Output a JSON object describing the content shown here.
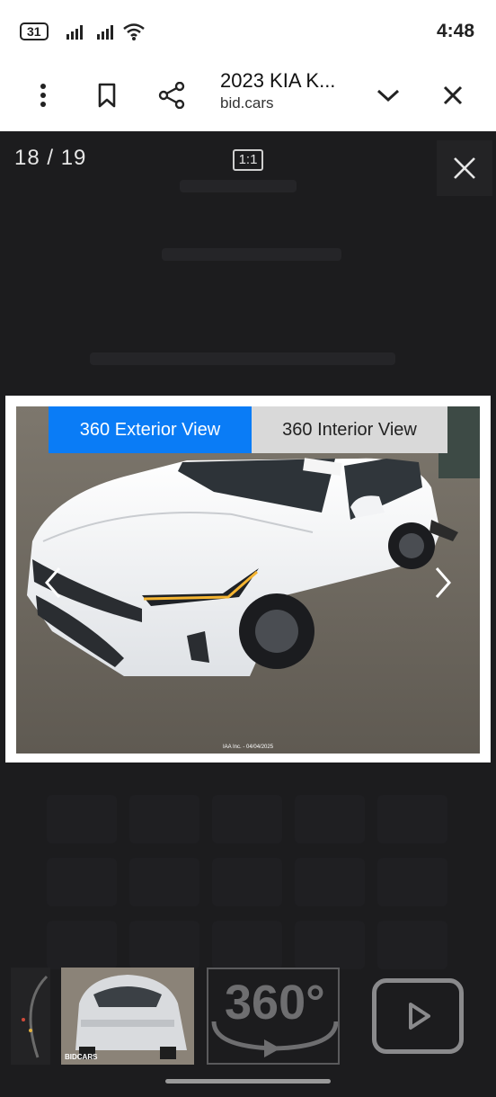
{
  "status_bar": {
    "badge": "31",
    "time": "4:48"
  },
  "browser": {
    "title": "2023 KIA K...",
    "domain": "bid.cars"
  },
  "gallery": {
    "counter": "18 / 19",
    "zoom_label": "1:1",
    "tabs": {
      "exterior": "360 Exterior View",
      "interior": "360 Interior View"
    },
    "photo_credit": "IAA Inc. - 04/04/2025"
  },
  "thumbnails": {
    "thumb2_watermark": "BIDCARS",
    "view360_label": "360°"
  },
  "colors": {
    "accent_blue": "#0a7cf6",
    "inactive_tab": "#d9d9d9",
    "background": "#1c1c1e"
  },
  "icons": [
    "more-vert-icon",
    "bookmark-icon",
    "share-icon",
    "chevron-down-icon",
    "close-icon",
    "wifi-icon",
    "play-icon",
    "360-icon"
  ]
}
